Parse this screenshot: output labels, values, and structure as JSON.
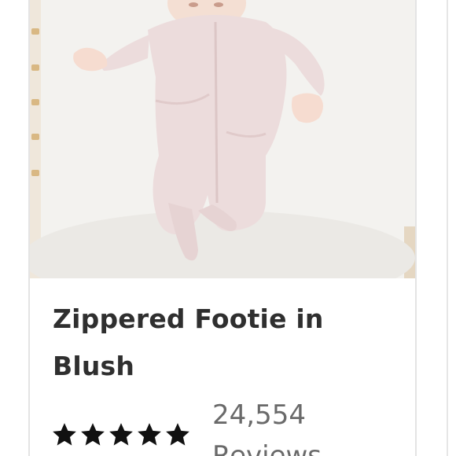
{
  "product": {
    "title": "Zippered Footie in Blush",
    "image_icon": "baby-footie-photo",
    "rating": 5,
    "rating_max": 5,
    "review_count": "24,554",
    "review_label": "Reviews"
  },
  "colors": {
    "title": "#2f2f2f",
    "star": "#111111",
    "muted_text": "#6a6a6a",
    "card_border": "#e4e4e4",
    "garment": "#ecdcdc"
  }
}
